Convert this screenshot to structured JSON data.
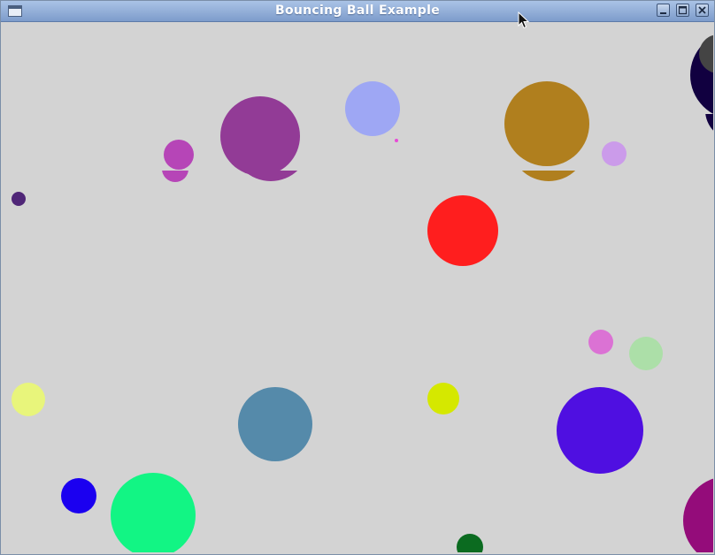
{
  "window": {
    "title": "Bouncing Ball Example",
    "controls": {
      "minimize_icon": "minimize-icon",
      "maximize_icon": "maximize-icon",
      "close_icon": "close-icon"
    },
    "app_icon": "window-icon"
  },
  "canvas": {
    "background": "#d3d3d3",
    "balls": [
      {
        "color": "#4f2677"
      },
      {
        "color": "#b645b7"
      },
      {
        "color": "#923b96"
      },
      {
        "color": "#9ea7f4"
      },
      {
        "color": "#e74bd6"
      },
      {
        "color": "#b07f1e"
      },
      {
        "color": "#cb9bea"
      },
      {
        "color": "#110040"
      },
      {
        "color": "#444444"
      },
      {
        "color": "#ff1e1e"
      },
      {
        "color": "#db72d4"
      },
      {
        "color": "#acdfa8"
      },
      {
        "color": "#e8f57b"
      },
      {
        "color": "#558aaa"
      },
      {
        "color": "#d5e800"
      },
      {
        "color": "#4f0fe1"
      },
      {
        "color": "#1b00f0"
      },
      {
        "color": "#12f584"
      },
      {
        "color": "#0b6b20"
      },
      {
        "color": "#940c7a"
      }
    ]
  },
  "cursor_icon": "mouse-pointer-icon"
}
